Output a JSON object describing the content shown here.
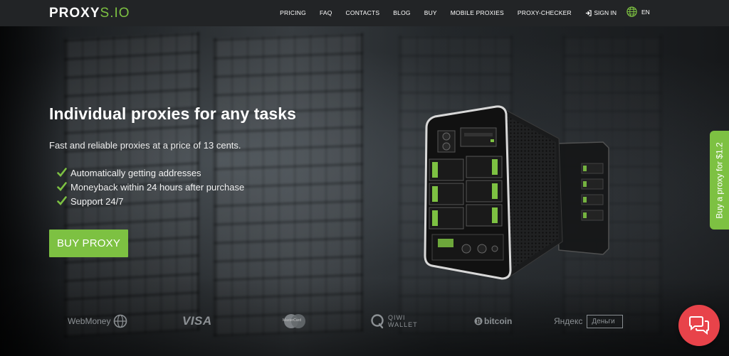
{
  "brand": {
    "logo_bold": "PROXY",
    "logo_thin": "S.IO",
    "accent_color": "#7dc142",
    "header_bg": "#222426"
  },
  "nav": {
    "items": [
      {
        "label": "PRICING"
      },
      {
        "label": "FAQ"
      },
      {
        "label": "CONTACTS"
      },
      {
        "label": "BLOG"
      },
      {
        "label": "BUY"
      },
      {
        "label": "MOBILE PROXIES"
      },
      {
        "label": "PROXY-CHECKER"
      }
    ],
    "sign_in": "SIGN IN",
    "sign_in_icon": "sign-in-icon",
    "language": "EN",
    "language_icon": "globe-icon"
  },
  "hero": {
    "title": "Individual proxies for any tasks",
    "subtitle": "Fast and reliable proxies at a price of 13 cents.",
    "features": [
      "Automatically getting addresses",
      "Moneyback within 24 hours after purchase",
      "Support 24/7"
    ],
    "feature_icon": "check-icon",
    "cta_label": "BUY PROXY"
  },
  "side_tab": {
    "label": "Buy a proxy for $1.2"
  },
  "payments": {
    "webmoney": "WebMoney",
    "visa": "VISA",
    "mastercard": "MasterCard",
    "qiwi_line1": "QIWI",
    "qiwi_line2": "WALLET",
    "bitcoin": "bitcoin",
    "yandex_left": "Яндекс",
    "yandex_right": "Деньги"
  },
  "chat": {
    "icon": "chat-icon",
    "color": "#e8434a"
  }
}
